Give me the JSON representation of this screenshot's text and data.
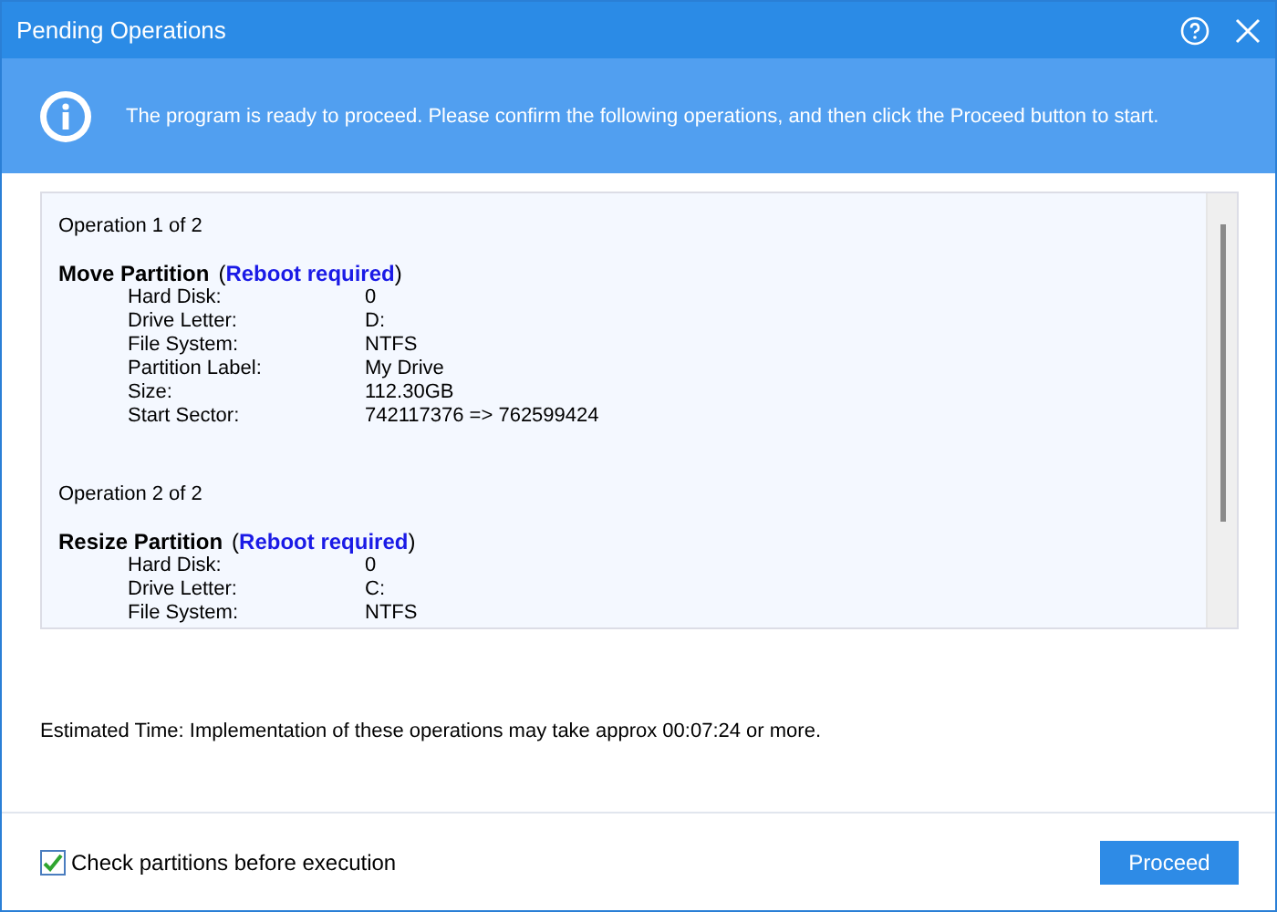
{
  "window": {
    "title": "Pending Operations"
  },
  "banner": {
    "message": "The program is ready to proceed. Please confirm the following operations, and then click the Proceed button to start."
  },
  "operations": [
    {
      "counter": "Operation 1 of 2",
      "name": "Move Partition",
      "note_open": "(",
      "note": "Reboot required",
      "note_close": ")",
      "details": [
        {
          "label": "Hard Disk:",
          "value": "0"
        },
        {
          "label": "Drive Letter:",
          "value": "D:"
        },
        {
          "label": "File System:",
          "value": "NTFS"
        },
        {
          "label": "Partition Label:",
          "value": "My Drive"
        },
        {
          "label": "Size:",
          "value": "112.30GB"
        },
        {
          "label": "Start Sector:",
          "value": "742117376 => 762599424"
        }
      ]
    },
    {
      "counter": "Operation 2 of 2",
      "name": "Resize Partition",
      "note_open": "(",
      "note": "Reboot required",
      "note_close": ")",
      "details": [
        {
          "label": "Hard Disk:",
          "value": "0"
        },
        {
          "label": "Drive Letter:",
          "value": "C:"
        },
        {
          "label": "File System:",
          "value": "NTFS"
        }
      ]
    }
  ],
  "estimate": "Estimated Time: Implementation of these operations may take approx 00:07:24 or more.",
  "check_option": {
    "label": "Check partitions before execution",
    "checked": true
  },
  "buttons": [
    {
      "label": "Proceed"
    }
  ]
}
